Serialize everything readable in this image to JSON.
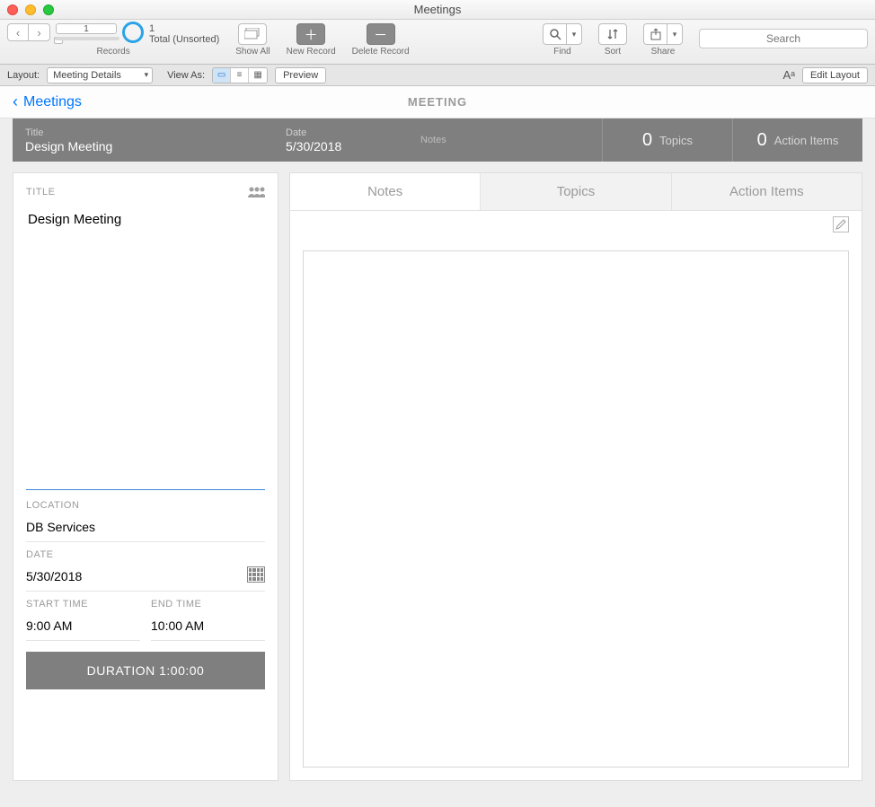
{
  "window_title": "Meetings",
  "toolbar": {
    "record_current": "1",
    "record_total_line1": "1",
    "record_total_line2": "Total (Unsorted)",
    "records_label": "Records",
    "show_all": "Show All",
    "new_record": "New Record",
    "delete_record": "Delete Record",
    "find": "Find",
    "sort": "Sort",
    "share": "Share",
    "search_placeholder": "Search"
  },
  "layoutbar": {
    "layout_label": "Layout:",
    "layout_value": "Meeting Details",
    "view_as_label": "View As:",
    "preview": "Preview",
    "aa_label": "Aᵃ",
    "edit_layout": "Edit Layout"
  },
  "breadcrumb": {
    "back": "Meetings",
    "center": "MEETING"
  },
  "header": {
    "title_label": "Title",
    "title_value": "Design Meeting",
    "date_label": "Date",
    "date_value": "5/30/2018",
    "notes_label": "Notes",
    "topics_count": "0",
    "topics_label": "Topics",
    "actions_count": "0",
    "actions_label": "Action Items"
  },
  "left_panel": {
    "title_label": "TITLE",
    "title_value": "Design Meeting",
    "location_label": "LOCATION",
    "location_value": "DB Services",
    "date_label": "DATE",
    "date_value": "5/30/2018",
    "start_label": "START TIME",
    "start_value": "9:00 AM",
    "end_label": "END TIME",
    "end_value": "10:00 AM",
    "duration": "DURATION 1:00:00"
  },
  "tabs": {
    "notes": "Notes",
    "topics": "Topics",
    "action_items": "Action Items"
  }
}
